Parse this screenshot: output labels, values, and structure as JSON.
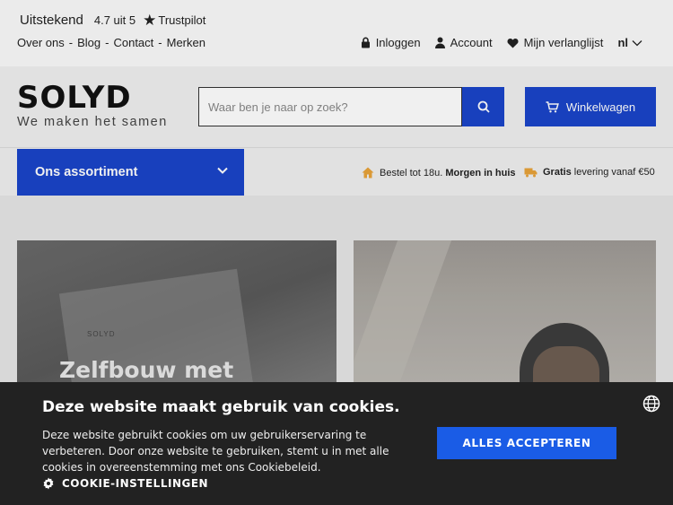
{
  "trustpilot": {
    "rating_label": "Uitstekend",
    "score": "4.7 uit 5",
    "brand": "Trustpilot"
  },
  "top_links": [
    "Over ons",
    "Blog",
    "Contact",
    "Merken"
  ],
  "top_links_separator": "-",
  "account_menu": {
    "login": "Inloggen",
    "account": "Account",
    "wishlist": "Mijn verlanglijst",
    "language": "nl"
  },
  "logo": {
    "wordmark": "SOLYD",
    "tagline": "We maken het samen"
  },
  "search": {
    "placeholder": "Waar ben je naar op zoek?"
  },
  "cart": {
    "label": "Winkelwagen"
  },
  "nav": {
    "assortment_label": "Ons assortiment"
  },
  "usps": {
    "delivery_prefix": "Bestel tot 18u.",
    "delivery_bold": "Morgen in huis",
    "shipping_bold": "Gratis",
    "shipping_suffix": "levering vanaf €50"
  },
  "banners": {
    "left_headline": "Zelfbouw met",
    "left_box_label": "SOLYD"
  },
  "cookie": {
    "title": "Deze website maakt gebruik van cookies.",
    "body": "Deze website gebruikt cookies om uw gebruikerservaring te verbeteren. Door onze website te gebruiken, stemt u in met alle cookies in overeenstemming met ons Cookiebeleid.",
    "accept_label": "ALLES ACCEPTEREN",
    "settings_label": "COOKIE-INSTELLINGEN"
  },
  "colors": {
    "brand_blue": "#1a45c9",
    "cookie_accept_blue": "#1a5ce6",
    "usp_icon_orange": "#e8a33a"
  }
}
